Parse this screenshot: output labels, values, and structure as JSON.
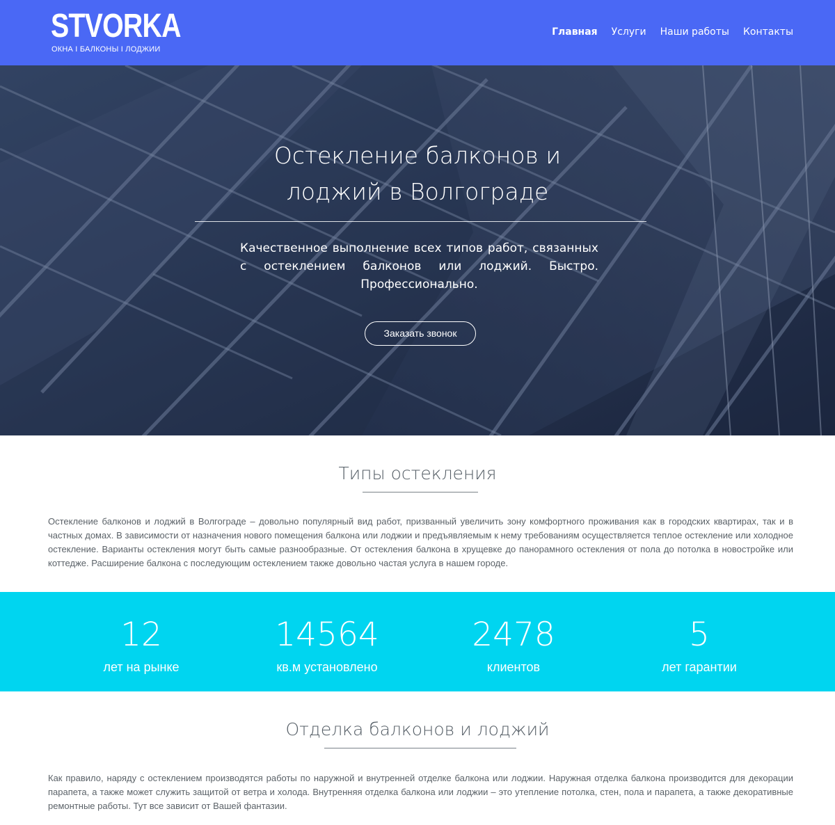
{
  "header": {
    "logo_word": "STVORKA",
    "logo_tagline": "ОКНА I БАЛКОНЫ I ЛОДЖИИ",
    "nav": [
      {
        "label": "Главная",
        "active": true
      },
      {
        "label": "Услуги",
        "active": false
      },
      {
        "label": "Наши работы",
        "active": false
      },
      {
        "label": "Контакты",
        "active": false
      }
    ],
    "background_color": "#4a68f5"
  },
  "hero": {
    "title_line1": "Остекление балконов и",
    "title_line2": "лоджий в Волгограде",
    "subtitle": "Качественное выполнение всех типов работ, связанных с остеклением балконов или лоджий. Быстро. Профессионально.",
    "cta_label": "Заказать звонок"
  },
  "glazing": {
    "title": "Типы остекления",
    "text": "Остекление балконов и лоджий в Волгограде – довольно популярный вид работ, призванный увеличить зону комфортного проживания как в городских квартирах, так и в частных домах. В зависимости от назначения нового помещения балкона или лоджии и предъявляемым к нему требованиям осуществляется теплое остекление или холодное остекление. Варианты остекления могут быть самые разнообразные. От остекления балкона в хрущевке до панорамного остекления от пола до потолка в новостройке или коттедже. Расширение балкона с последующим остеклением также довольно частая услуга в нашем городе."
  },
  "stats": {
    "background_color": "#00d5f0",
    "items": [
      {
        "value": "12",
        "label": "лет на рынке"
      },
      {
        "value": "14564",
        "label": "кв.м установлено"
      },
      {
        "value": "2478",
        "label": "клиентов"
      },
      {
        "value": "5",
        "label": "лет гарантии"
      }
    ]
  },
  "finishing": {
    "title": "Отделка балконов и лоджий",
    "text": "Как правило, наряду с остеклением производятся работы по наружной и внутренней отделке балкона или лоджии. Наружная отделка балкона производится для декорации парапета, а также может служить защитой от ветра и холода. Внутренняя отделка балкона или лоджии – это утепление потолка, стен, пола и парапета, а также декоративные ремонтные работы. Тут все зависит от Вашей фантазии."
  }
}
